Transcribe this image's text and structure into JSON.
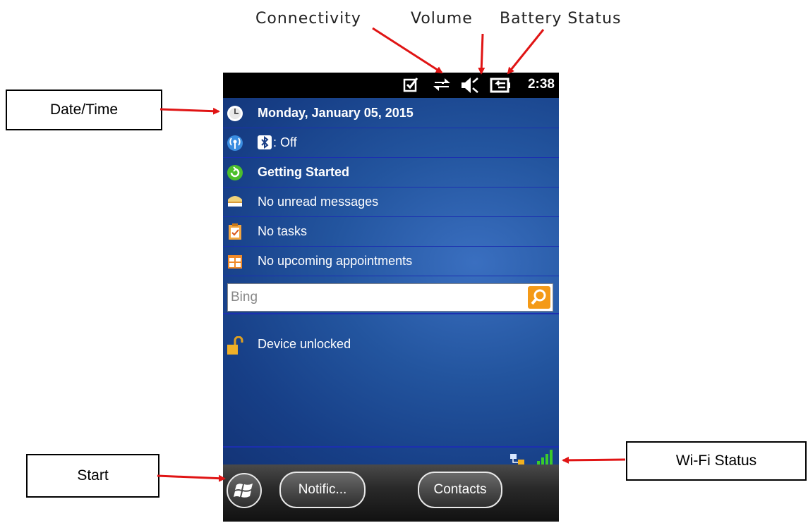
{
  "annotations": {
    "connectivity": "Connectivity",
    "volume": "Volume",
    "battery": "Battery Status",
    "datetime": "Date/Time",
    "wifi": "Wi-Fi Status",
    "start": "Start"
  },
  "statusbar": {
    "time": "2:38",
    "icons": [
      "checkbox-icon",
      "connectivity-arrows-icon",
      "volume-muted-icon",
      "battery-charging-icon"
    ]
  },
  "today": {
    "items": [
      {
        "icon": "clock-icon",
        "label": "Monday, January 05, 2015",
        "bold": true
      },
      {
        "icon": "wireless-icon",
        "label": ": Off",
        "bold": false
      },
      {
        "icon": "getting-started-icon",
        "label": "Getting Started",
        "bold": true
      },
      {
        "icon": "inbox-icon",
        "label": "No unread messages",
        "bold": false
      },
      {
        "icon": "tasks-icon",
        "label": "No tasks",
        "bold": false
      },
      {
        "icon": "calendar-icon",
        "label": "No upcoming appointments",
        "bold": false
      }
    ],
    "search_placeholder": "Bing",
    "lock_label": "Device unlocked"
  },
  "taskbar": {
    "notifications_label": "Notific...",
    "contacts_label": "Contacts"
  },
  "colors": {
    "arrow": "#e01414",
    "background": "#1a4a96",
    "divider": "#1c2fb0",
    "search_button": "#f49a17",
    "signal": "#3ccb2a"
  }
}
